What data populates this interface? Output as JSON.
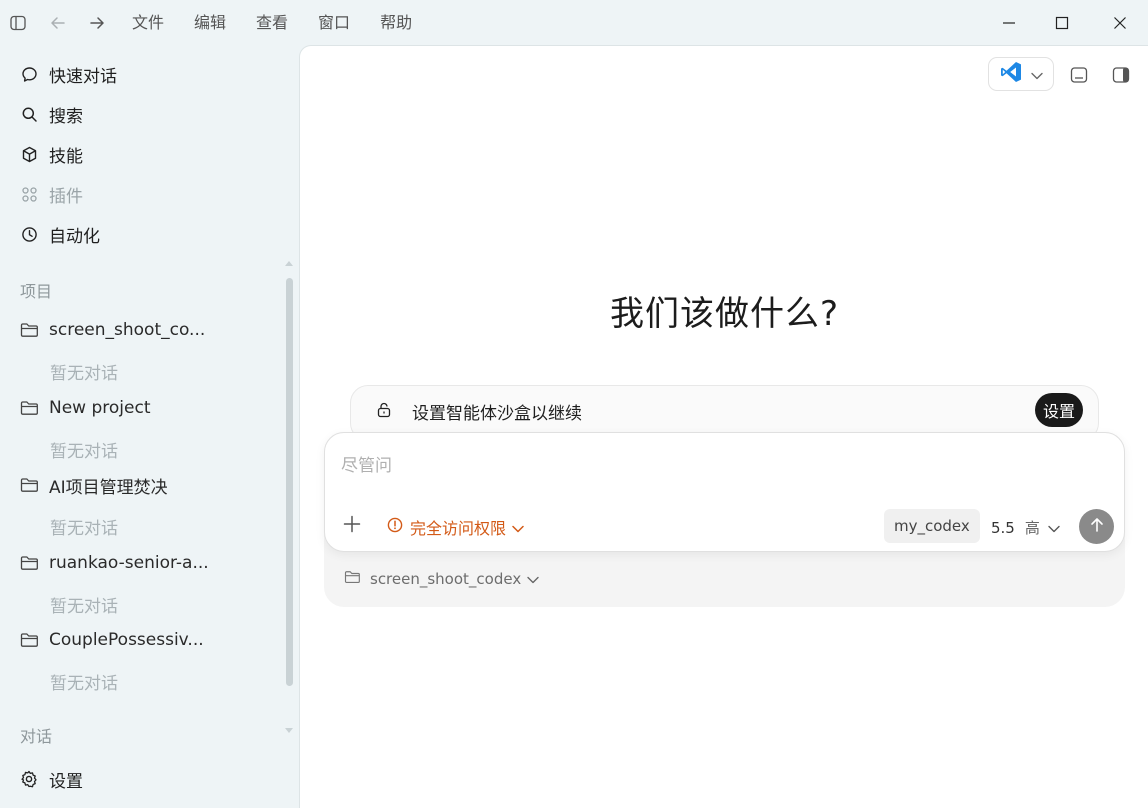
{
  "menu": [
    "文件",
    "编辑",
    "查看",
    "窗口",
    "帮助"
  ],
  "sidebar": {
    "nav": [
      {
        "label": "快速对话",
        "icon": "chat-bubble-icon"
      },
      {
        "label": "搜索",
        "icon": "search-icon"
      },
      {
        "label": "技能",
        "icon": "cube-icon"
      },
      {
        "label": "插件",
        "icon": "grid-icon"
      },
      {
        "label": "自动化",
        "icon": "clock-icon"
      }
    ],
    "projects_label": "项目",
    "projects": [
      {
        "name": "screen_shoot_co...",
        "empty": "暂无对话"
      },
      {
        "name": "New project",
        "empty": "暂无对话"
      },
      {
        "name": "AI项目管理焚决",
        "empty": "暂无对话"
      },
      {
        "name": "ruankao-senior-a...",
        "empty": "暂无对话"
      },
      {
        "name": "CouplePossessiv...",
        "empty": "暂无对话"
      }
    ],
    "conversations_label": "对话",
    "settings_label": "设置"
  },
  "main": {
    "heading": "我们该做什么?",
    "sandbox": {
      "text": "设置智能体沙盒以继续",
      "button": "设置"
    },
    "composer": {
      "placeholder": "尽管问",
      "access_label": "完全访问权限",
      "codex_chip": "my_codex",
      "model_version": "5.5",
      "model_level": "高"
    },
    "folder": "screen_shoot_codex"
  },
  "colors": {
    "accent_warning": "#d35a17",
    "vscode_blue": "#1e88e5"
  }
}
